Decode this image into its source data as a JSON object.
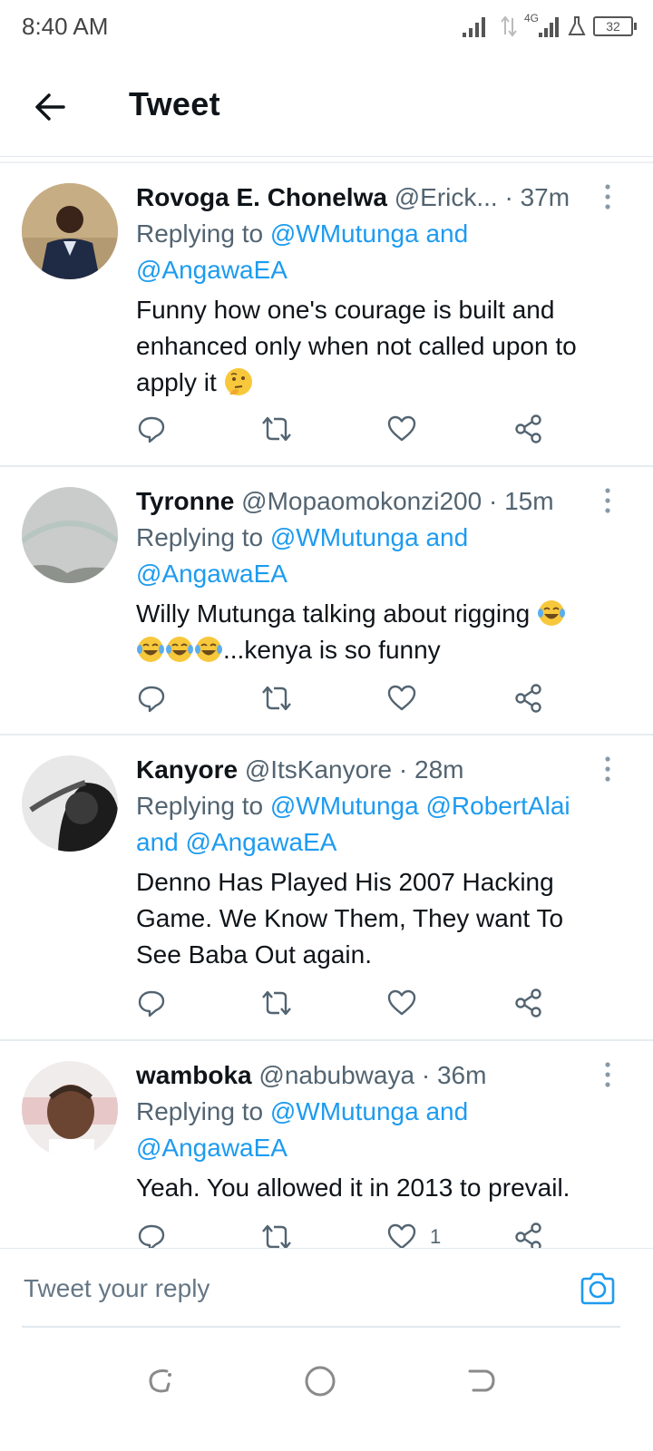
{
  "status_bar": {
    "time": "8:40 AM",
    "network": "4G",
    "battery": "32"
  },
  "header": {
    "title": "Tweet"
  },
  "tweets": [
    {
      "name": "Rovoga E. Chonelwa",
      "handle": "@Erick...",
      "separator": "·",
      "time": "37m",
      "replying_prefix": "Replying to ",
      "replying_line1": "@WMutunga and",
      "replying_line2": "@AngawaEA",
      "text_line1": "Funny how one's courage is built and",
      "text_line2": "enhanced only when not called upon to",
      "text_line3": "apply it",
      "likes": ""
    },
    {
      "name": "Tyronne",
      "handle": "@Mopaomokonzi200",
      "separator": "·",
      "time": "15m",
      "replying_prefix": "Replying to ",
      "replying_line1": "@WMutunga and",
      "replying_line2": "@AngawaEA",
      "text_line1": "Willy Mutunga talking about rigging",
      "text_line2": "...kenya is so funny",
      "likes": ""
    },
    {
      "name": "Kanyore",
      "handle": "@ItsKanyore",
      "separator": "·",
      "time": "28m",
      "replying_prefix": "Replying to ",
      "replying_line1": "@WMutunga @RobertAlai",
      "replying_line2": "and @AngawaEA",
      "text_line1": "Denno Has Played His 2007 Hacking",
      "text_line2": "Game. We Know Them, They want To",
      "text_line3": "See Baba Out again.",
      "likes": ""
    },
    {
      "name": "wamboka",
      "handle": "@nabubwaya",
      "separator": "·",
      "time": "36m",
      "replying_prefix": "Replying to ",
      "replying_line1": "@WMutunga and",
      "replying_line2": "@AngawaEA",
      "text_line1": "Yeah. You allowed it in 2013 to prevail.",
      "likes": "1"
    }
  ],
  "reply_bar": {
    "placeholder": "Tweet your reply"
  },
  "icons": {
    "back": "arrow-left-icon",
    "more": "more-vertical-icon",
    "reply": "reply-icon",
    "retweet": "retweet-icon",
    "like": "heart-icon",
    "share": "share-icon",
    "camera": "camera-icon"
  },
  "colors": {
    "accent": "#1d9bf0",
    "secondary_text": "#536471",
    "primary_text": "#0f1419"
  }
}
